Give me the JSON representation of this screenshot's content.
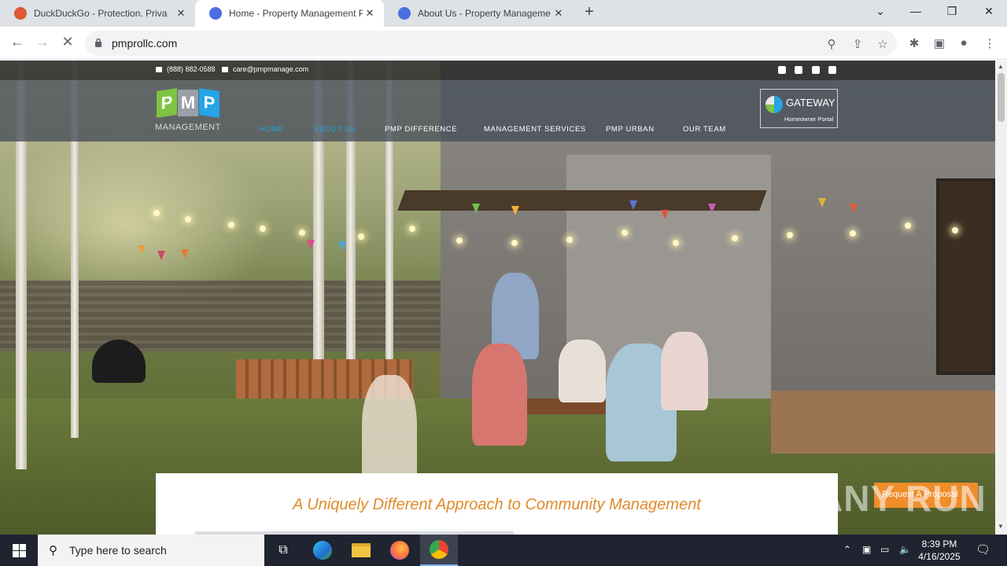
{
  "browser": {
    "tabs": [
      {
        "title": "DuckDuckGo - Protection. Privacy",
        "favicon_color": "#de5833"
      },
      {
        "title": "Home - Property Management P",
        "favicon_color": "#4a6ee0",
        "active": true
      },
      {
        "title": "About Us - Property Manageme",
        "favicon_color": "#4a6ee0"
      }
    ],
    "new_tab_symbol": "+",
    "url": "pmprollc.com"
  },
  "site": {
    "phone": "(888) 882-0588",
    "email": "care@pmpmanage.com",
    "logo_letters": [
      "P",
      "M",
      "P"
    ],
    "logo_colors": [
      "#7fc343",
      "#9aa0a8",
      "#25a4e6"
    ],
    "logo_sub": "MANAGEMENT",
    "nav": [
      "HOME",
      "ABOUT US",
      "PMP DIFFERENCE",
      "MANAGEMENT SERVICES",
      "PMP URBAN",
      "OUR TEAM"
    ],
    "gateway_name": "GATEWAY",
    "gateway_sub": "Homeowner Portal",
    "headline": "A Uniquely Different Approach to Community Management",
    "proposal_button": "Request A Proposal",
    "watermark": "ANY RUN"
  },
  "taskbar": {
    "search_placeholder": "Type here to search",
    "time": "8:39 PM",
    "date": "4/16/2025"
  }
}
